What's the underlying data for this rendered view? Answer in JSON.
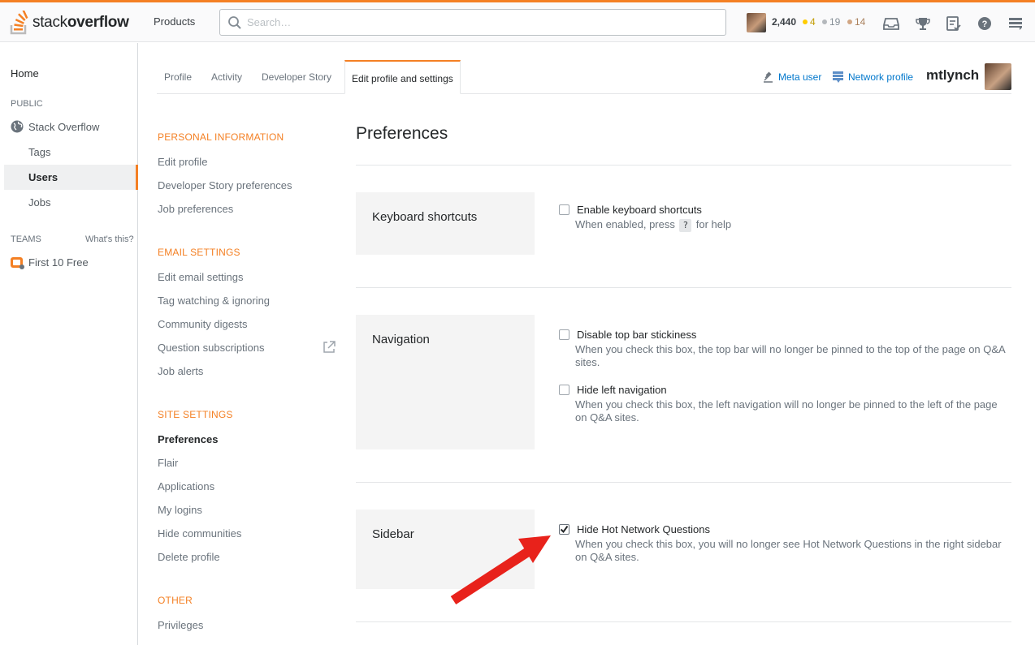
{
  "header": {
    "logo_light": "stack",
    "logo_bold": "overflow",
    "products_label": "Products",
    "search_placeholder": "Search…",
    "reputation": "2,440",
    "gold_count": "4",
    "silver_count": "19",
    "bronze_count": "14",
    "colors": {
      "gold": "#ffcc01",
      "silver": "#b4b8bc",
      "bronze": "#d1a684",
      "accent": "#f48024"
    },
    "icons": [
      "inbox-icon",
      "achievements-icon",
      "review-icon",
      "help-icon",
      "site-switcher-icon"
    ]
  },
  "leftnav": {
    "home": "Home",
    "public_heading": "PUBLIC",
    "stack_overflow": "Stack Overflow",
    "tags": "Tags",
    "users": "Users",
    "jobs": "Jobs",
    "teams_heading": "TEAMS",
    "whats_this": "What's this?",
    "first_free": "First 10 Free"
  },
  "tabs": {
    "profile": "Profile",
    "activity": "Activity",
    "developer_story": "Developer Story",
    "edit_profile": "Edit profile and settings",
    "meta_user": "Meta user",
    "network_profile": "Network profile",
    "username": "mtlynch"
  },
  "settings_menu": {
    "personal_heading": "PERSONAL INFORMATION",
    "edit_profile": "Edit profile",
    "dev_story_prefs": "Developer Story preferences",
    "job_prefs": "Job preferences",
    "email_heading": "EMAIL SETTINGS",
    "edit_email": "Edit email settings",
    "tag_watching": "Tag watching & ignoring",
    "community_digests": "Community digests",
    "question_subscriptions": "Question subscriptions",
    "job_alerts": "Job alerts",
    "site_heading": "SITE SETTINGS",
    "preferences": "Preferences",
    "flair": "Flair",
    "applications": "Applications",
    "my_logins": "My logins",
    "hide_communities": "Hide communities",
    "delete_profile": "Delete profile",
    "other_heading": "OTHER",
    "privileges": "Privileges"
  },
  "main": {
    "title": "Preferences",
    "keyboard": {
      "label": "Keyboard shortcuts",
      "opt_label": "Enable keyboard shortcuts",
      "opt_checked": false,
      "desc_before": "When enabled, press",
      "key": "?",
      "desc_after": "for help"
    },
    "navigation": {
      "label": "Navigation",
      "opt1_label": "Disable top bar stickiness",
      "opt1_checked": false,
      "opt1_desc": "When you check this box, the top bar will no longer be pinned to the top of the page on Q&A sites.",
      "opt2_label": "Hide left navigation",
      "opt2_checked": false,
      "opt2_desc": "When you check this box, the left navigation will no longer be pinned to the left of the page on Q&A sites."
    },
    "sidebar": {
      "label": "Sidebar",
      "opt_label": "Hide Hot Network Questions",
      "opt_checked": true,
      "opt_desc": "When you check this box, you will no longer see Hot Network Questions in the right sidebar on Q&A sites."
    },
    "annotation_color": "#e8221b"
  }
}
